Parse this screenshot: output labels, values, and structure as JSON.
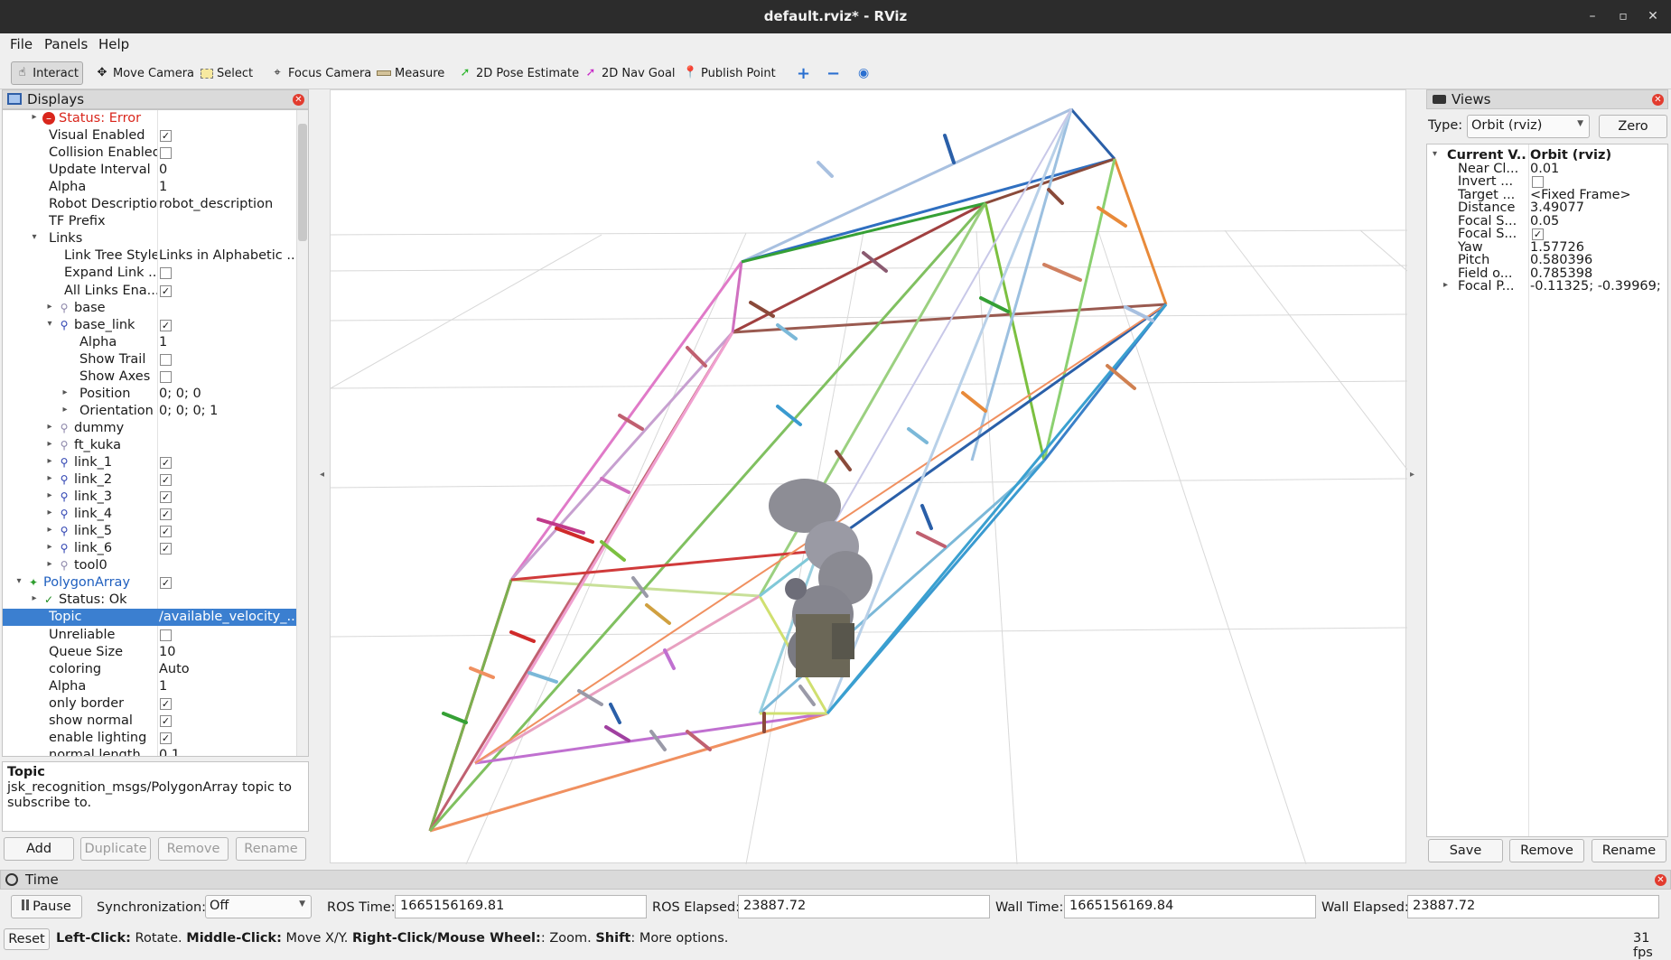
{
  "window": {
    "title": "default.rviz* - RViz",
    "minimize": "–",
    "restore": "▫",
    "close": "✕"
  },
  "menu": {
    "file": "File",
    "panels": "Panels",
    "help": "Help"
  },
  "toolbar": {
    "interact": "Interact",
    "move_camera": "Move Camera",
    "select": "Select",
    "focus_camera": "Focus Camera",
    "measure": "Measure",
    "pose_estimate": "2D Pose Estimate",
    "nav_goal": "2D Nav Goal",
    "publish_point": "Publish Point",
    "plus": "+",
    "minus": "−",
    "eye": "◉"
  },
  "displays": {
    "title": "Displays",
    "rows": [
      {
        "name": "Status: Error",
        "indent": 2,
        "arrow": "▸",
        "icon": "error",
        "cls": "err"
      },
      {
        "name": "Visual Enabled",
        "indent": 2,
        "check": true
      },
      {
        "name": "Collision Enabled",
        "indent": 2,
        "check": false
      },
      {
        "name": "Update Interval",
        "indent": 2,
        "value": "0"
      },
      {
        "name": "Alpha",
        "indent": 2,
        "value": "1"
      },
      {
        "name": "Robot Description",
        "indent": 2,
        "value": "robot_description"
      },
      {
        "name": "TF Prefix",
        "indent": 2,
        "value": ""
      },
      {
        "name": "Links",
        "indent": 2,
        "arrow": "▾"
      },
      {
        "name": "Link Tree Style",
        "indent": 3,
        "value": "Links in Alphabetic ..."
      },
      {
        "name": "Expand Link ...",
        "indent": 3,
        "check": false
      },
      {
        "name": "All Links Ena...",
        "indent": 3,
        "check": true
      },
      {
        "name": "base",
        "indent": 3,
        "arrow": "▸",
        "icon": "link"
      },
      {
        "name": "base_link",
        "indent": 3,
        "arrow": "▾",
        "icon": "link",
        "check": true
      },
      {
        "name": "Alpha",
        "indent": 4,
        "value": "1"
      },
      {
        "name": "Show Trail",
        "indent": 4,
        "check": false
      },
      {
        "name": "Show Axes",
        "indent": 4,
        "check": false
      },
      {
        "name": "Position",
        "indent": 4,
        "arrow": "▸",
        "value": "0; 0; 0"
      },
      {
        "name": "Orientation",
        "indent": 4,
        "arrow": "▸",
        "value": "0; 0; 0; 1"
      },
      {
        "name": "dummy",
        "indent": 3,
        "arrow": "▸",
        "icon": "link"
      },
      {
        "name": "ft_kuka",
        "indent": 3,
        "arrow": "▸",
        "icon": "link"
      },
      {
        "name": "link_1",
        "indent": 3,
        "arrow": "▸",
        "icon": "link",
        "check": true
      },
      {
        "name": "link_2",
        "indent": 3,
        "arrow": "▸",
        "icon": "link",
        "check": true
      },
      {
        "name": "link_3",
        "indent": 3,
        "arrow": "▸",
        "icon": "link",
        "check": true
      },
      {
        "name": "link_4",
        "indent": 3,
        "arrow": "▸",
        "icon": "link",
        "check": true
      },
      {
        "name": "link_5",
        "indent": 3,
        "arrow": "▸",
        "icon": "link",
        "check": true
      },
      {
        "name": "link_6",
        "indent": 3,
        "arrow": "▸",
        "icon": "link",
        "check": true
      },
      {
        "name": "tool0",
        "indent": 3,
        "arrow": "▸",
        "icon": "link"
      },
      {
        "name": "PolygonArray",
        "indent": 1,
        "arrow": "▾",
        "icon": "polygon",
        "check": true,
        "cls": "blue"
      },
      {
        "name": "Status: Ok",
        "indent": 2,
        "arrow": "▸",
        "icon": "ok"
      },
      {
        "name": "Topic",
        "indent": 2,
        "value": "/available_velocity_...",
        "selected": true
      },
      {
        "name": "Unreliable",
        "indent": 2,
        "check": false
      },
      {
        "name": "Queue Size",
        "indent": 2,
        "value": "10"
      },
      {
        "name": "coloring",
        "indent": 2,
        "value": "Auto"
      },
      {
        "name": "Alpha",
        "indent": 2,
        "value": "1"
      },
      {
        "name": "only border",
        "indent": 2,
        "check": true
      },
      {
        "name": "show normal",
        "indent": 2,
        "check": true
      },
      {
        "name": "enable lighting",
        "indent": 2,
        "check": true
      },
      {
        "name": "normal length",
        "indent": 2,
        "value": "0.1"
      }
    ],
    "desc_title": "Topic",
    "desc_text": "jsk_recognition_msgs/PolygonArray topic to subscribe to.",
    "buttons": {
      "add": "Add",
      "duplicate": "Duplicate",
      "remove": "Remove",
      "rename": "Rename"
    }
  },
  "views": {
    "title": "Views",
    "type_label": "Type:",
    "type_value": "Orbit (rviz)",
    "zero": "Zero",
    "rows": [
      {
        "name": "Current V...",
        "value": "Orbit (rviz)",
        "arrow": "▾",
        "bold": true,
        "indent": 0
      },
      {
        "name": "Near Cl...",
        "value": "0.01",
        "indent": 1
      },
      {
        "name": "Invert ...",
        "check": false,
        "indent": 1
      },
      {
        "name": "Target ...",
        "value": "<Fixed Frame>",
        "indent": 1
      },
      {
        "name": "Distance",
        "value": "3.49077",
        "indent": 1
      },
      {
        "name": "Focal S...",
        "value": "0.05",
        "indent": 1
      },
      {
        "name": "Focal S...",
        "check": true,
        "indent": 1
      },
      {
        "name": "Yaw",
        "value": "1.57726",
        "indent": 1
      },
      {
        "name": "Pitch",
        "value": "0.580396",
        "indent": 1
      },
      {
        "name": "Field o...",
        "value": "0.785398",
        "indent": 1
      },
      {
        "name": "Focal P...",
        "value": "-0.11325; -0.39969; ...",
        "arrow": "▸",
        "indent": 1
      }
    ],
    "buttons": {
      "save": "Save",
      "remove": "Remove",
      "rename": "Rename"
    }
  },
  "time": {
    "title": "Time",
    "pause": "Pause",
    "sync_label": "Synchronization:",
    "sync_value": "Off",
    "ros_time_label": "ROS Time:",
    "ros_time": "1665156169.81",
    "ros_elapsed_label": "ROS Elapsed:",
    "ros_elapsed": "23887.72",
    "wall_time_label": "Wall Time:",
    "wall_time": "1665156169.84",
    "wall_elapsed_label": "Wall Elapsed:",
    "wall_elapsed": "23887.72"
  },
  "status": {
    "reset": "Reset",
    "hint_1_key": "Left-Click:",
    "hint_1": " Rotate. ",
    "hint_2_key": "Middle-Click:",
    "hint_2": " Move X/Y. ",
    "hint_3_key": "Right-Click/Mouse Wheel:",
    "hint_3": ": Zoom. ",
    "hint_4_key": "Shift",
    "hint_4": ": More options.",
    "fps": "31 fps"
  },
  "colors": {
    "selection": "#3b7fd0",
    "error": "#d9261c",
    "blue_text": "#1f5fbf",
    "titlebar": "#2c2c2c"
  }
}
